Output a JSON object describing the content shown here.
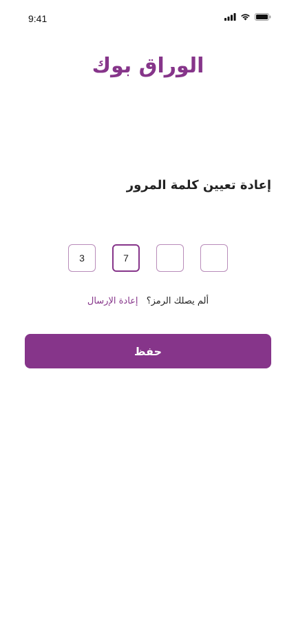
{
  "status_bar": {
    "time": "9:41",
    "icons": [
      "signal-icon",
      "wifi-icon",
      "battery-icon"
    ]
  },
  "brand": {
    "logo_text": "الوراق بوك",
    "accent_color": "#86358a"
  },
  "title": "إعادة تعيين كلمة المرور",
  "otp": {
    "boxes": [
      {
        "value": "3",
        "state": "filled"
      },
      {
        "value": "7",
        "state": "active"
      },
      {
        "value": "",
        "state": "empty"
      },
      {
        "value": "",
        "state": "empty"
      }
    ]
  },
  "resend": {
    "question": "ألم يصلك الرمز؟",
    "link": "إعادة الإرسال"
  },
  "save_button": {
    "label": "حفظ"
  }
}
